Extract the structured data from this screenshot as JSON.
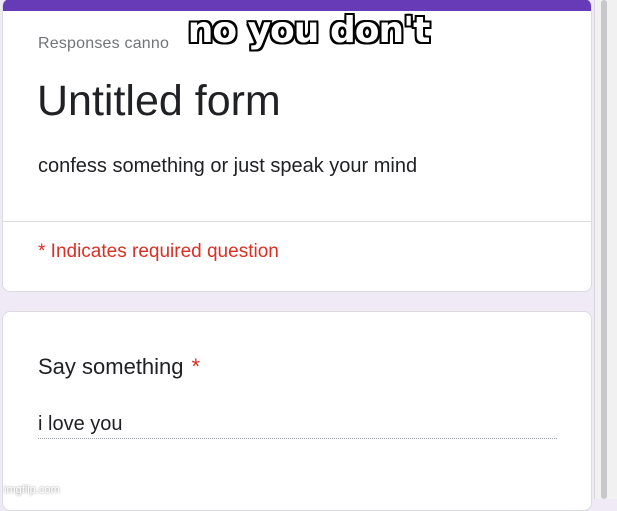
{
  "header": {
    "responses_note": "Responses canno",
    "form_title": "Untitled form",
    "form_description": "confess something or just speak your mind",
    "required_note": "* Indicates required question"
  },
  "question": {
    "title": "Say something",
    "required_marker": "*",
    "answer": "i love you"
  },
  "overlay": {
    "caption": "no you don't",
    "watermark": "imgflip.com"
  },
  "colors": {
    "accent": "#673ab7",
    "required": "#d93025",
    "background": "#efeaf6"
  }
}
